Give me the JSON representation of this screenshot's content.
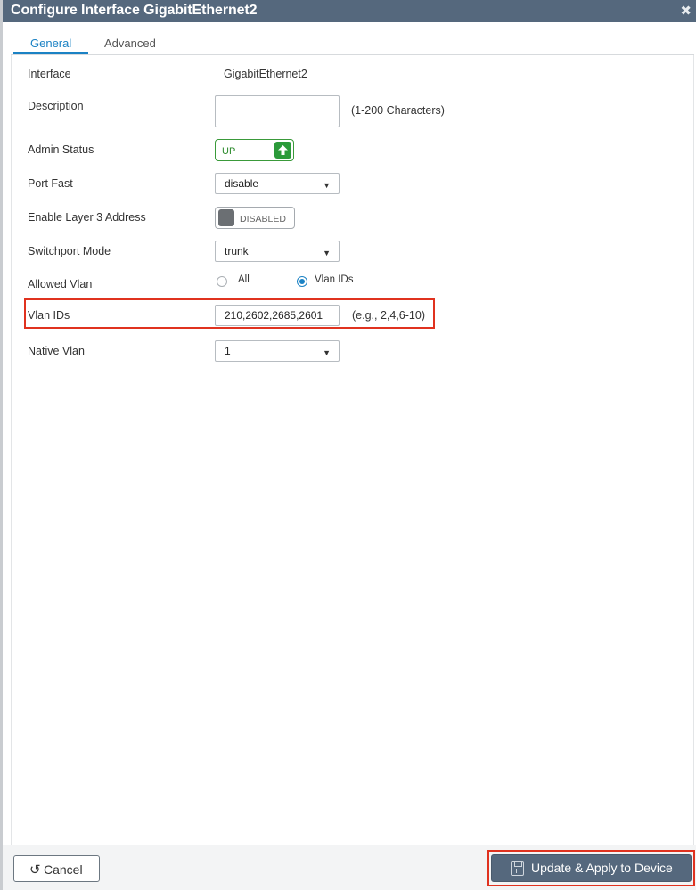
{
  "dialog": {
    "title": "Configure Interface GigabitEthernet2",
    "close_glyph": "✖"
  },
  "tabs": [
    {
      "label": "General",
      "active": true
    },
    {
      "label": "Advanced",
      "active": false
    }
  ],
  "form": {
    "interface": {
      "label": "Interface",
      "value": "GigabitEthernet2"
    },
    "description": {
      "label": "Description",
      "value": "",
      "hint": "(1-200 Characters)"
    },
    "admin_status": {
      "label": "Admin Status",
      "state_text": "UP",
      "icon": "arrow-up-icon"
    },
    "port_fast": {
      "label": "Port Fast",
      "selected": "disable"
    },
    "layer3": {
      "label": "Enable Layer 3 Address",
      "state_text": "DISABLED"
    },
    "switchport_mode": {
      "label": "Switchport Mode",
      "selected": "trunk"
    },
    "allowed_vlan": {
      "label": "Allowed Vlan",
      "options": [
        {
          "label": "All",
          "checked": false
        },
        {
          "label": "Vlan IDs",
          "checked": true
        }
      ]
    },
    "vlan_ids": {
      "label": "Vlan IDs",
      "value": "210,2602,2685,2601",
      "hint": "(e.g., 2,4,6-10)"
    },
    "native_vlan": {
      "label": "Native Vlan",
      "selected": "1"
    }
  },
  "footer": {
    "cancel_label": "Cancel",
    "cancel_icon": "undo-icon",
    "apply_label": "Update & Apply to Device",
    "apply_icon": "save-icon"
  },
  "colors": {
    "titlebar": "#55687d",
    "accent": "#1b82c4",
    "status_up": "#2b9a3a",
    "highlight": "#e0321f"
  }
}
